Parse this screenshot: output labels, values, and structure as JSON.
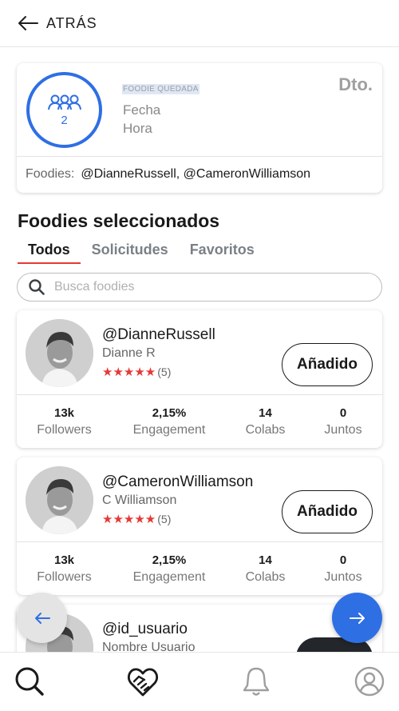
{
  "header": {
    "back_label": "ATRÁS"
  },
  "meetup": {
    "group_count": "2",
    "type_label": "FOODIE QUEDADA",
    "date_label": "Fecha",
    "time_label": "Hora",
    "discount_label": "Dto.",
    "foodies_key": "Foodies:",
    "foodies_value": "@DianneRussell, @CameronWilliamson"
  },
  "section": {
    "title": "Foodies seleccionados"
  },
  "tabs": [
    {
      "label": "Todos",
      "active": true
    },
    {
      "label": "Solicitudes",
      "active": false
    },
    {
      "label": "Favoritos",
      "active": false
    }
  ],
  "search": {
    "placeholder": "Busca foodies",
    "value": ""
  },
  "foodies": [
    {
      "handle": "@DianneRussell",
      "name": "Dianne R",
      "stars": "★★★★★",
      "reviews": "(5)",
      "button": "Añadido",
      "stats": [
        {
          "value": "13k",
          "label": "Followers"
        },
        {
          "value": "2,15%",
          "label": "Engagement"
        },
        {
          "value": "14",
          "label": "Colabs"
        },
        {
          "value": "0",
          "label": "Juntos"
        }
      ]
    },
    {
      "handle": "@CameronWilliamson",
      "name": "C Williamson",
      "stars": "★★★★★",
      "reviews": "(5)",
      "button": "Añadido",
      "stats": [
        {
          "value": "13k",
          "label": "Followers"
        },
        {
          "value": "2,15%",
          "label": "Engagement"
        },
        {
          "value": "14",
          "label": "Colabs"
        },
        {
          "value": "0",
          "label": "Juntos"
        }
      ]
    },
    {
      "handle": "@id_usuario",
      "name": "Nombre Usuario"
    }
  ],
  "colors": {
    "accent_blue": "#2e6fe4",
    "accent_red": "#e53935",
    "text_dark": "#1a1a1a",
    "text_muted": "#777777"
  },
  "icons": {
    "back": "arrow-left-icon",
    "group": "group-icon",
    "search": "search-icon",
    "prev": "arrow-left-icon",
    "next": "arrow-right-icon",
    "nav": [
      "search-icon",
      "handshake-heart-icon",
      "bell-icon",
      "profile-icon"
    ]
  }
}
